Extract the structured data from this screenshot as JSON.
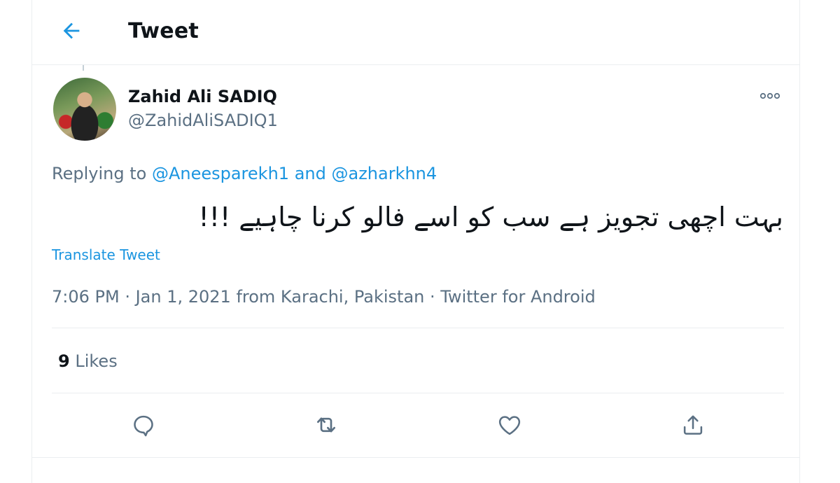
{
  "header": {
    "title": "Tweet",
    "back_icon": "arrow-left-icon"
  },
  "tweet": {
    "author": {
      "display_name": "Zahid Ali SADIQ",
      "handle": "@ZahidAliSADIQ1"
    },
    "replying": {
      "prefix": "Replying to",
      "mention_1": "@Aneesparekh1",
      "conjunction": "and",
      "mention_2": "@azharkhn4"
    },
    "text": "بہت اچھی تجویز ہے سب کو اسے فالو کرنا چاہیے !!!",
    "translate_label": "Translate Tweet",
    "meta": "7:06 PM · Jan 1, 2021 from Karachi, Pakistan · Twitter for Android",
    "likes_count": "9",
    "likes_label": "Likes"
  },
  "actions": [
    {
      "name": "reply",
      "icon": "reply-icon"
    },
    {
      "name": "retweet",
      "icon": "retweet-icon"
    },
    {
      "name": "like",
      "icon": "heart-icon"
    },
    {
      "name": "share",
      "icon": "share-icon"
    }
  ],
  "colors": {
    "accent": "#1b95e0",
    "secondary_text": "#5b7083",
    "border": "#ebeef0"
  }
}
